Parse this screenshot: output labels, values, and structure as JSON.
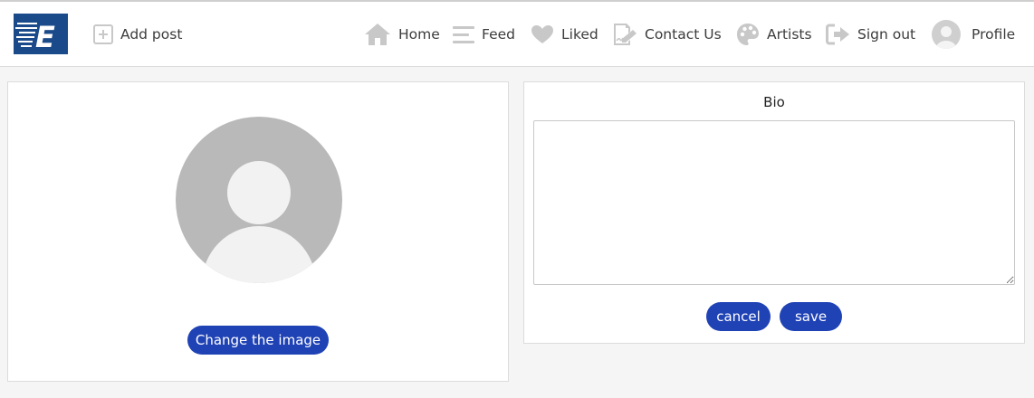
{
  "navbar": {
    "logo_letter": "E",
    "add_post": "Add post",
    "items": [
      {
        "label": "Home",
        "icon": "home-icon"
      },
      {
        "label": "Feed",
        "icon": "feed-icon"
      },
      {
        "label": "Liked",
        "icon": "heart-icon"
      },
      {
        "label": "Contact Us",
        "icon": "edit-icon"
      },
      {
        "label": "Artists",
        "icon": "palette-icon"
      },
      {
        "label": "Sign out",
        "icon": "sign-out-icon"
      }
    ],
    "profile": "Profile"
  },
  "profile_card": {
    "change_image_label": "Change the image"
  },
  "bio_card": {
    "title": "Bio",
    "bio_value": "",
    "cancel_label": "cancel",
    "save_label": "save"
  },
  "colors": {
    "accent": "#1f42b5",
    "logo_bg": "#1a4a8a",
    "icon_gray": "#c8c8c8"
  }
}
